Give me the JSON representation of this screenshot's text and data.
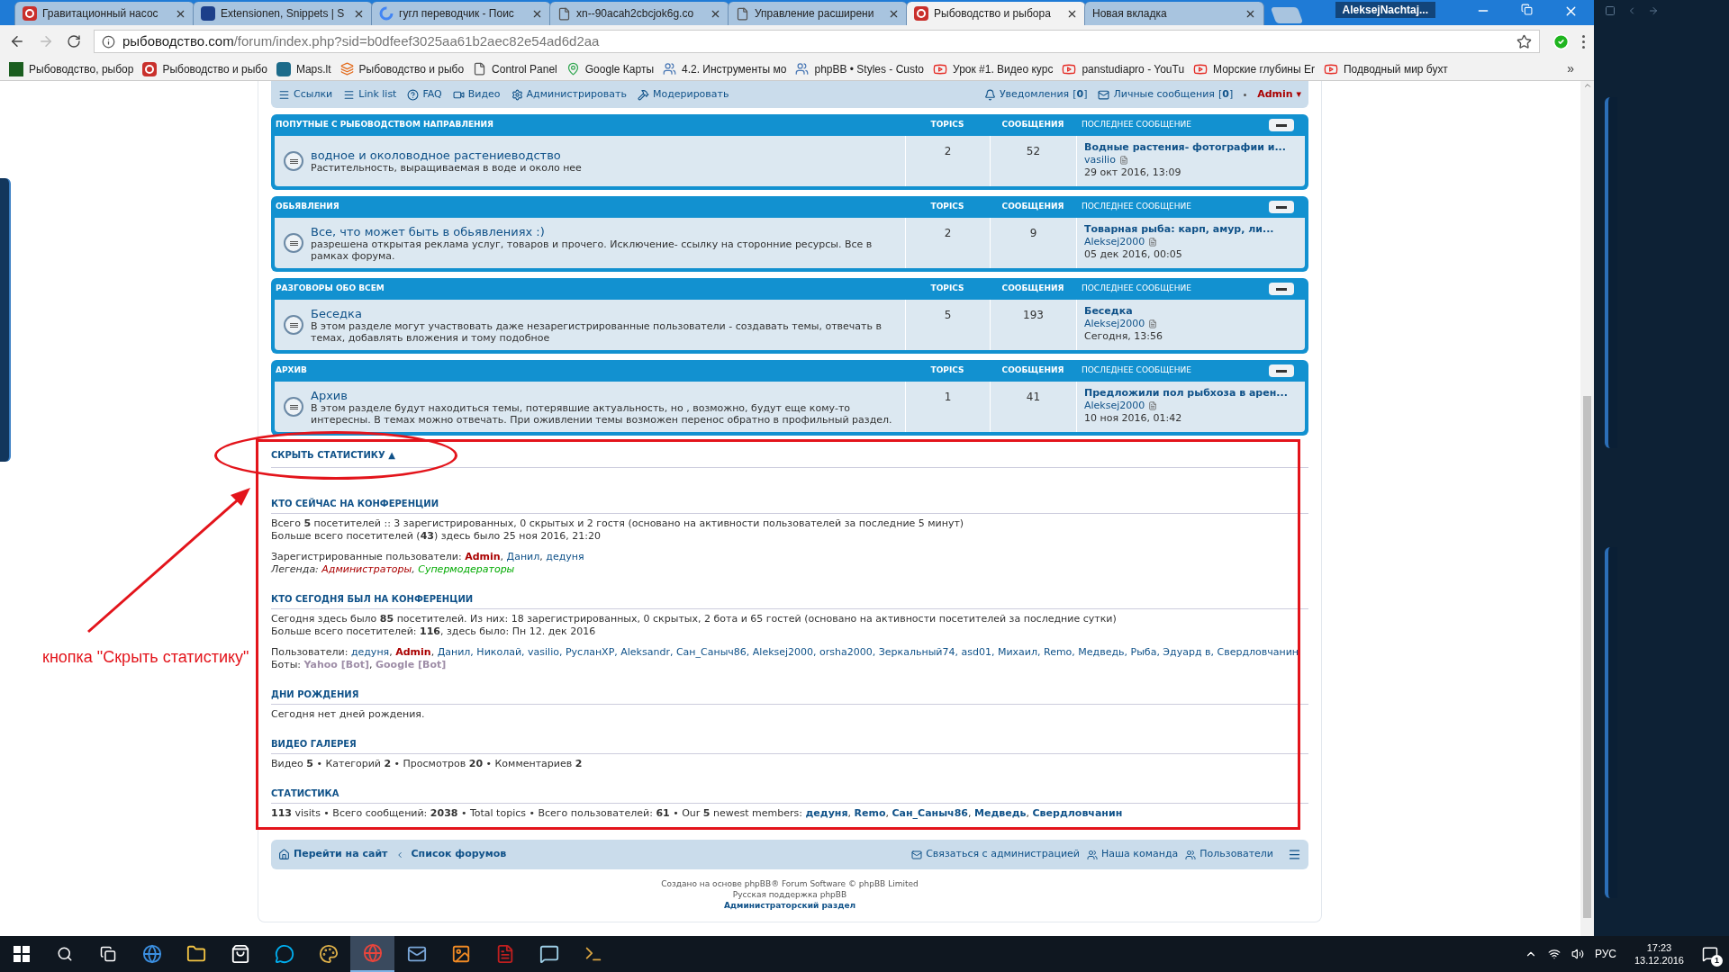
{
  "browser": {
    "tabs": [
      {
        "title": "Гравитационный насос",
        "kind": "red",
        "selected": false
      },
      {
        "title": "Extensionen, Snippets | S",
        "kind": "blue",
        "selected": false
      },
      {
        "title": "гугл переводчик - Поис",
        "kind": "google",
        "selected": false
      },
      {
        "title": "xn--90acah2cbcjok6g.co",
        "kind": "page",
        "selected": false
      },
      {
        "title": "Управление расширени",
        "kind": "page",
        "selected": false
      },
      {
        "title": "Рыбоводство и рыбора",
        "kind": "red",
        "selected": true
      },
      {
        "title": "Новая вкладка",
        "kind": "none",
        "selected": false
      }
    ],
    "profile": "AleksejNachtaj...",
    "url": {
      "host": "рыбоводство.com",
      "path": "/forum/index.php?sid=b0dfeef3025aa61b2aec82e54ad6d2aa"
    },
    "bookmarks": [
      {
        "title": "Рыбоводство, рыбор",
        "kind": "green"
      },
      {
        "title": "Рыбоводство и рыбо",
        "kind": "red"
      },
      {
        "title": "Maps.lt",
        "kind": "teal"
      },
      {
        "title": "Рыбоводство и рыбо",
        "kind": "joomla"
      },
      {
        "title": "Control Panel",
        "kind": "page"
      },
      {
        "title": "Google Карты",
        "kind": "map"
      },
      {
        "title": "4.2. Инструменты мо",
        "kind": "people"
      },
      {
        "title": "phpBB • Styles - Custo",
        "kind": "people"
      },
      {
        "title": "Урок #1. Видео курс",
        "kind": "youtube"
      },
      {
        "title": "panstudiapro - YouTu",
        "kind": "youtube"
      },
      {
        "title": "Морские глубины Er",
        "kind": "youtube"
      },
      {
        "title": "Подводный мир бухт",
        "kind": "youtube"
      }
    ],
    "more": "»"
  },
  "navbar": {
    "links": [
      {
        "label": "Ссылки",
        "kind": "menu"
      },
      {
        "label": "Link list",
        "kind": "menu"
      },
      {
        "label": "FAQ",
        "kind": "help"
      },
      {
        "label": "Видео",
        "kind": "video"
      },
      {
        "label": "Администрировать",
        "kind": "gear"
      },
      {
        "label": "Модерировать",
        "kind": "hammer"
      }
    ],
    "notifications": {
      "label": "Уведомления",
      "count": "[**0**]"
    },
    "messages": {
      "label": "Личные сообщения",
      "count": "[**0**]"
    },
    "user": "Admin",
    "caret": "▾"
  },
  "categories": [
    {
      "title": "ПОПУТНЫЕ С РЫБОВОДСТВОМ НАПРАВЛЕНИЯ",
      "columns": [
        "TOPICS",
        "СООБЩЕНИЯ",
        "ПОСЛЕДНЕЕ СООБЩЕНИЕ"
      ],
      "forums": [
        {
          "name": "водное и околоводное растениеводство",
          "description": "Растительность, выращиваемая в воде и около нее",
          "topics": "2",
          "posts": "52",
          "last_title": "Водные растения- фотографии и...",
          "last_author": "vasilio",
          "last_date": "29 окт 2016, 13:09"
        }
      ]
    },
    {
      "title": "ОБЬЯВЛЕНИЯ",
      "columns": [
        "TOPICS",
        "СООБЩЕНИЯ",
        "ПОСЛЕДНЕЕ СООБЩЕНИЕ"
      ],
      "forums": [
        {
          "name": "Все, что может быть в обьявлениях :)",
          "description": "разрешена открытая реклама услуг, товаров и прочего. Исключение- ссылку на сторонние ресурсы. Все в рамках форума.",
          "topics": "2",
          "posts": "9",
          "last_title": "Товарная рыба: карп, амур, ли...",
          "last_author": "Aleksej2000",
          "last_date": "05 дек 2016, 00:05"
        }
      ]
    },
    {
      "title": "РАЗГОВОРЫ ОБО ВСЕМ",
      "columns": [
        "TOPICS",
        "СООБЩЕНИЯ",
        "ПОСЛЕДНЕЕ СООБЩЕНИЕ"
      ],
      "forums": [
        {
          "name": "Беседка",
          "description": "В этом разделе могут участвовать даже незарегистрированные пользователи - создавать темы, отвечать в темах, добавлять вложения и тому подобное",
          "topics": "5",
          "posts": "193",
          "last_title": "Беседка",
          "last_author": "Aleksej2000",
          "last_date": "Сегодня, 13:56"
        }
      ]
    },
    {
      "title": "АРХИВ",
      "columns": [
        "TOPICS",
        "СООБЩЕНИЯ",
        "ПОСЛЕДНЕЕ СООБЩЕНИЕ"
      ],
      "forums": [
        {
          "name": "Архив",
          "description": "В этом разделе будут находиться темы, потерявшие актуальность, но , возможно, будут еще кому-то интересны. В темах можно отвечать. При оживлении темы возможен перенос обратно в профильный раздел.",
          "topics": "1",
          "posts": "41",
          "last_title": "Предложили пол рыбхоза в арен...",
          "last_author": "Aleksej2000",
          "last_date": "10 ноя 2016, 01:42"
        }
      ]
    }
  ],
  "stats": {
    "toggle": "СКРЫТЬ СТАТИСТИКУ",
    "toggle_arrow": "▲",
    "sections": [
      {
        "heading": "КТО СЕЙЧАС НА КОНФЕРЕНЦИИ",
        "blocks": [
          [
            {
              "segs": [
                {
                  "t": "Всего "
                },
                {
                  "t": "5",
                  "kind": "num"
                },
                {
                  "t": " посетителей :: 3 зарегистрированных, 0 скрытых и 2 гостя (основано на активности пользователей за последние 5 минут)"
                }
              ]
            },
            {
              "segs": [
                {
                  "t": "Больше всего посетителей ("
                },
                {
                  "t": "43",
                  "kind": "num"
                },
                {
                  "t": ") здесь было 25 ноя 2016, 21:20"
                }
              ]
            }
          ],
          [
            {
              "segs": [
                {
                  "t": "Зарегистрированные пользователи: "
                },
                {
                  "t": "Admin",
                  "kind": "admin"
                },
                {
                  "t": ", "
                },
                {
                  "t": "Данил",
                  "kind": "user"
                },
                {
                  "t": ", "
                },
                {
                  "t": "дедуня",
                  "kind": "user"
                }
              ]
            },
            {
              "italic": true,
              "segs": [
                {
                  "t": "Легенда: "
                },
                {
                  "t": "Администраторы",
                  "kind": "admin-group"
                },
                {
                  "t": ", "
                },
                {
                  "t": "Супермодераторы",
                  "kind": "mod-group"
                }
              ]
            }
          ]
        ]
      },
      {
        "heading": "КТО СЕГОДНЯ БЫЛ НА КОНФЕРЕНЦИИ",
        "blocks": [
          [
            {
              "segs": [
                {
                  "t": "Сегодня здесь было "
                },
                {
                  "t": "85",
                  "kind": "num"
                },
                {
                  "t": " посетителей. Из них: 18 зарегистрированных, 0 скрытых, 2 бота и 65 гостей (основано на активности посетителей за последние сутки)"
                }
              ]
            },
            {
              "segs": [
                {
                  "t": "Больше всего посетителей: "
                },
                {
                  "t": "116",
                  "kind": "num"
                },
                {
                  "t": ", здесь было: Пн 12. дек 2016"
                }
              ]
            }
          ],
          [
            {
              "segs": [
                {
                  "t": "Пользователи: "
                },
                {
                  "t": "дедуня",
                  "kind": "user"
                },
                {
                  "t": ", "
                },
                {
                  "t": "Admin",
                  "kind": "admin"
                },
                {
                  "t": ", "
                },
                {
                  "t": "Данил, Николай, vasilio, РусланXP, Aleksandr, Сан_Саныч86, Aleksej2000, orsha2000, Зеркальный74, asd01, Михаил, Remo, Медведь, Рыба, Эдуард в, Свердловчанин",
                  "kind": "user"
                }
              ]
            },
            {
              "segs": [
                {
                  "t": "Боты: "
                },
                {
                  "t": "Yahoo [Bot]",
                  "kind": "bot"
                },
                {
                  "t": ", "
                },
                {
                  "t": "Google [Bot]",
                  "kind": "bot"
                }
              ]
            }
          ]
        ]
      },
      {
        "heading": "ДНИ РОЖДЕНИЯ",
        "blocks": [
          [
            {
              "segs": [
                {
                  "t": "Сегодня нет дней рождения."
                }
              ]
            }
          ]
        ]
      },
      {
        "heading": "ВИДЕО ГАЛЕРЕЯ",
        "blocks": [
          [
            {
              "segs": [
                {
                  "t": "Видео "
                },
                {
                  "t": "5",
                  "kind": "num"
                },
                {
                  "t": " • Категорий "
                },
                {
                  "t": "2",
                  "kind": "num"
                },
                {
                  "t": " • Просмотров "
                },
                {
                  "t": "20",
                  "kind": "num"
                },
                {
                  "t": " • Комментариев "
                },
                {
                  "t": "2",
                  "kind": "num"
                }
              ]
            }
          ]
        ]
      },
      {
        "heading": "СТАТИСТИКА",
        "blocks": [
          [
            {
              "segs": [
                {
                  "t": "113",
                  "kind": "num"
                },
                {
                  "t": " visits • Всего сообщений: "
                },
                {
                  "t": "2038",
                  "kind": "num"
                },
                {
                  "t": " • Total topics • Всего пользователей: "
                },
                {
                  "t": "61",
                  "kind": "num"
                },
                {
                  "t": " • Our "
                },
                {
                  "t": "5",
                  "kind": "num"
                },
                {
                  "t": " newest members: "
                },
                {
                  "t": "дедуня",
                  "kind": "link"
                },
                {
                  "t": ", "
                },
                {
                  "t": "Remo",
                  "kind": "link"
                },
                {
                  "t": ", "
                },
                {
                  "t": "Сан_Саныч86",
                  "kind": "link"
                },
                {
                  "t": ", "
                },
                {
                  "t": "Медведь",
                  "kind": "link"
                },
                {
                  "t": ", "
                },
                {
                  "t": "Свердловчанин",
                  "kind": "link"
                }
              ]
            }
          ]
        ]
      }
    ]
  },
  "footer": {
    "home": "Перейти на сайт",
    "forums": "Список форумов",
    "contact": "Связаться с администрацией",
    "team": "Наша команда",
    "members": "Пользователи",
    "credits": [
      "Создано на основе phpBB® Forum Software © phpBB Limited",
      "Русская поддержка phpBB"
    ],
    "admin_link": "Администраторский раздел"
  },
  "annotation": {
    "label": "кнопка \"Скрыть статистику\""
  },
  "taskbar": {
    "apps": [
      {
        "kind": "edge",
        "selected": false
      },
      {
        "kind": "folder",
        "selected": false
      },
      {
        "kind": "store",
        "selected": false
      },
      {
        "kind": "skype",
        "selected": false
      },
      {
        "kind": "paint",
        "selected": false
      },
      {
        "kind": "chrome",
        "selected": true
      },
      {
        "kind": "mail",
        "selected": false
      },
      {
        "kind": "photos",
        "selected": false
      },
      {
        "kind": "filezilla",
        "selected": false
      },
      {
        "kind": "notepad",
        "selected": false
      },
      {
        "kind": "terminal",
        "selected": false
      }
    ],
    "lang": "РУС",
    "time": "17:23",
    "date": "13.12.2016",
    "badge": "1"
  }
}
